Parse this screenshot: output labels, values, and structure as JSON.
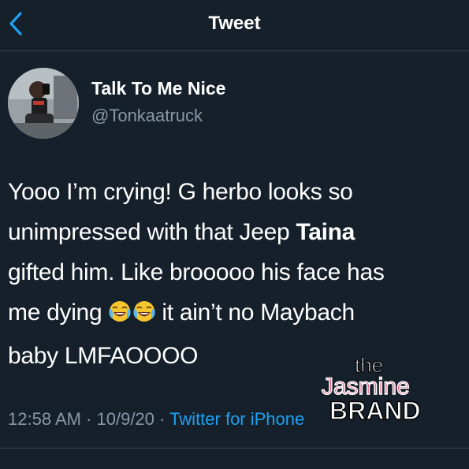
{
  "nav": {
    "title": "Tweet"
  },
  "tweet": {
    "author": {
      "display_name": "Talk To Me Nice",
      "handle": "@Tonkaatruck"
    },
    "lines": {
      "l1": "Yooo I’m crying!  G herbo looks so",
      "l2a": "unimpressed with that Jeep ",
      "l2b": "Taina",
      "l3": "gifted him. Like brooooo his face has",
      "l4a": "me dying ",
      "l4b": " it ain’t no Maybach",
      "l5": "baby LMFAOOOO"
    },
    "time": "12:58 AM · 10/9/20 · ",
    "source": "Twitter for iPhone"
  },
  "watermark": {
    "line1": "the",
    "line2": "Jasmine",
    "line3": "BRAND"
  },
  "colors": {
    "background": "#15202b",
    "accent": "#1da1f2",
    "secondary_text": "#8899a6",
    "watermark_pink": "#e8537a"
  },
  "icons": {
    "back": "chevron-left-icon",
    "emoji": "face-with-tears-of-joy-icon"
  }
}
